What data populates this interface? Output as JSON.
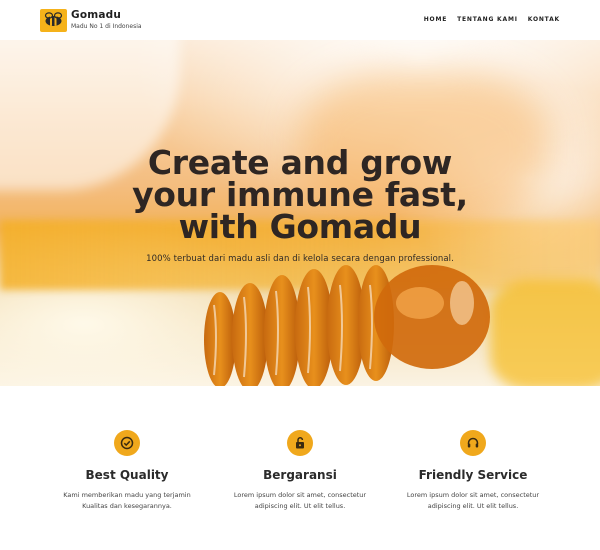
{
  "header": {
    "brand": "Gomadu",
    "tagline": "Madu No 1 di Indonesia",
    "nav": [
      "HOME",
      "TENTANG KAMI",
      "KONTAK"
    ]
  },
  "hero": {
    "title_lines": [
      "Create and grow",
      "your immune fast,",
      "with Gomadu"
    ],
    "subtitle": "100% terbuat dari madu asli dan di kelola secara dengan professional."
  },
  "features": [
    {
      "icon": "check-circle-icon",
      "title": "Best Quality",
      "desc": "Kami memberikan madu yang terjamin Kualitas dan kesegarannya."
    },
    {
      "icon": "unlock-icon",
      "title": "Bergaransi",
      "desc": "Lorem ipsum dolor sit amet, consectetur adipiscing elit. Ut elit tellus."
    },
    {
      "icon": "headset-icon",
      "title": "Friendly Service",
      "desc": "Lorem ipsum dolor sit amet, consectetur adipiscing elit. Ut elit tellus."
    }
  ],
  "colors": {
    "accent": "#f0a81c",
    "text": "#2b2b2b"
  }
}
